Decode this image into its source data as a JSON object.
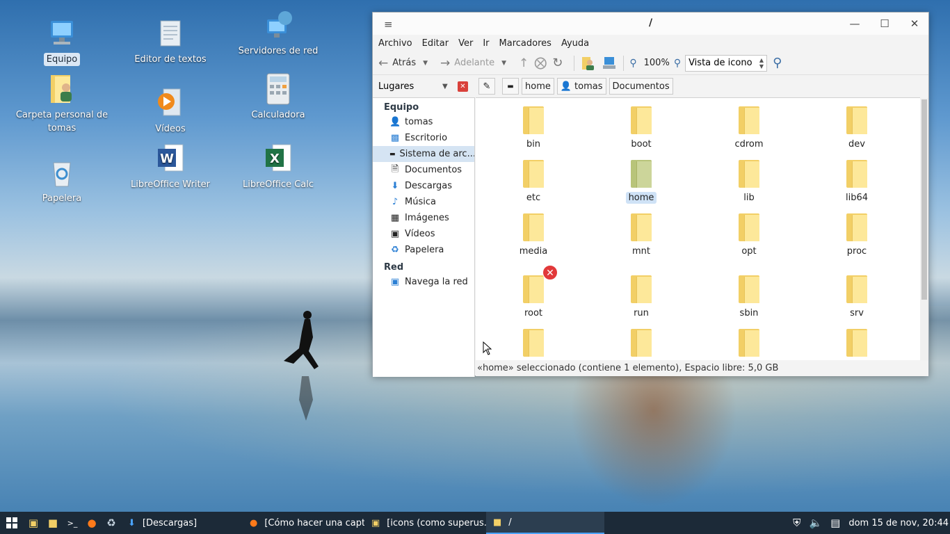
{
  "desktop": {
    "icons": [
      {
        "label": "Equipo",
        "icon": "computer-icon"
      },
      {
        "label": "Editor de textos",
        "icon": "text-editor-icon"
      },
      {
        "label": "Servidores de red",
        "icon": "network-servers-icon"
      },
      {
        "label": "Carpeta personal de tomas",
        "icon": "home-folder-icon"
      },
      {
        "label": "Vídeos",
        "icon": "videos-icon"
      },
      {
        "label": "Calculadora",
        "icon": "calculator-icon"
      },
      {
        "label": "Papelera",
        "icon": "trash-icon"
      },
      {
        "label": "LibreOffice Writer",
        "icon": "writer-icon"
      },
      {
        "label": "LibreOffice Calc",
        "icon": "calc-icon"
      }
    ]
  },
  "window": {
    "title": "/",
    "menu": [
      "Archivo",
      "Editar",
      "Ver",
      "Ir",
      "Marcadores",
      "Ayuda"
    ],
    "toolbar": {
      "back_label": "Atrás",
      "forward_label": "Adelante",
      "zoom_level": "100%",
      "view_mode": "Vista de icono"
    },
    "side_pane_mode": "Lugares",
    "breadcrumbs": [
      "home",
      "tomas",
      "Documentos"
    ],
    "sidebar": {
      "sections": [
        {
          "title": "Equipo",
          "items": [
            {
              "label": "tomas",
              "icon": "user-home-icon"
            },
            {
              "label": "Escritorio",
              "icon": "desktop-icon"
            },
            {
              "label": "Sistema de arc...",
              "icon": "drive-icon",
              "selected": true
            },
            {
              "label": "Documentos",
              "icon": "documents-icon"
            },
            {
              "label": "Descargas",
              "icon": "downloads-icon"
            },
            {
              "label": "Música",
              "icon": "music-icon"
            },
            {
              "label": "Imágenes",
              "icon": "images-icon"
            },
            {
              "label": "Vídeos",
              "icon": "videos-icon"
            },
            {
              "label": "Papelera",
              "icon": "trash-icon"
            }
          ]
        },
        {
          "title": "Red",
          "items": [
            {
              "label": "Navega la red",
              "icon": "network-icon"
            }
          ]
        }
      ]
    },
    "folders": [
      {
        "name": "bin"
      },
      {
        "name": "boot"
      },
      {
        "name": "cdrom"
      },
      {
        "name": "dev"
      },
      {
        "name": "etc"
      },
      {
        "name": "home",
        "selected": true
      },
      {
        "name": "lib"
      },
      {
        "name": "lib64"
      },
      {
        "name": "media"
      },
      {
        "name": "mnt"
      },
      {
        "name": "opt"
      },
      {
        "name": "proc"
      },
      {
        "name": "root",
        "locked": true
      },
      {
        "name": "run"
      },
      {
        "name": "sbin"
      },
      {
        "name": "srv"
      },
      {
        "name": ""
      },
      {
        "name": ""
      },
      {
        "name": ""
      },
      {
        "name": ""
      }
    ],
    "status": "«home» seleccionado (contiene 1 elemento), Espacio libre: 5,0 GB"
  },
  "taskbar": {
    "tasks": [
      {
        "label": "[Descargas]",
        "icon": "download-arrow-icon"
      },
      {
        "label": "[Cómo hacer una capt...",
        "icon": "firefox-icon"
      },
      {
        "label": "[icons (como superus...",
        "icon": "file-manager-icon"
      },
      {
        "label": "/",
        "icon": "folder-icon",
        "active": true
      }
    ],
    "clock": "dom 15 de nov, 20:44"
  }
}
